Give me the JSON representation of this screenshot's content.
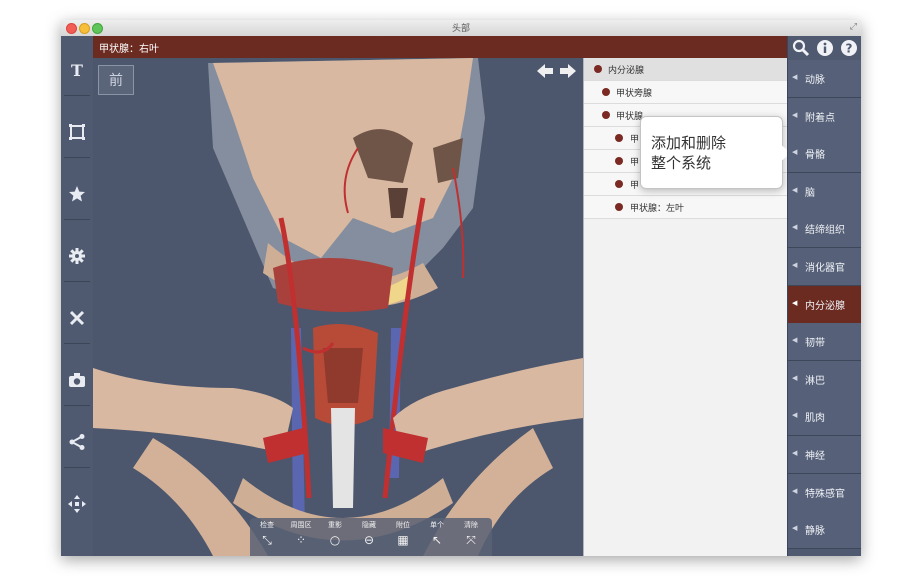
{
  "window": {
    "title": "头部"
  },
  "selection": {
    "label": "甲状腺：右叶"
  },
  "viewport": {
    "view_label": "前"
  },
  "left_toolbar": {
    "items": [
      "text-tool",
      "frame-tool",
      "favorite-tool",
      "settings-tool",
      "dissect-tool",
      "camera-tool",
      "share-tool",
      "move-tool"
    ]
  },
  "bottom_toolbar": {
    "items": [
      {
        "label": "检查",
        "icon": "inspect-icon"
      },
      {
        "label": "周围区",
        "icon": "surrounding-icon"
      },
      {
        "label": "重影",
        "icon": "ghost-icon"
      },
      {
        "label": "隐藏",
        "icon": "hide-icon"
      },
      {
        "label": "附位",
        "icon": "grid-icon"
      },
      {
        "label": "单个",
        "icon": "single-select-icon"
      },
      {
        "label": "清除",
        "icon": "clear-icon"
      }
    ]
  },
  "tree": {
    "rows": [
      "内分泌腺",
      "甲状旁腺",
      "甲状腺",
      "甲",
      "甲",
      "甲",
      "甲状腺：左叶"
    ]
  },
  "tooltip": {
    "text": "添加和删除\n整个系统"
  },
  "systems": {
    "items": [
      "动脉",
      "附着点",
      "骨骼",
      "脑",
      "结缔组织",
      "消化器官",
      "内分泌腺",
      "韧带",
      "淋巴",
      "肌肉",
      "神经",
      "特殊感官",
      "静脉"
    ],
    "active": "内分泌腺"
  },
  "colors": {
    "header": "#6b2b21",
    "panel": "#4f5a70",
    "background": "#4c566c",
    "bone": "#d8b8a0",
    "artery": "#c03030",
    "vein": "#5a66b0"
  }
}
